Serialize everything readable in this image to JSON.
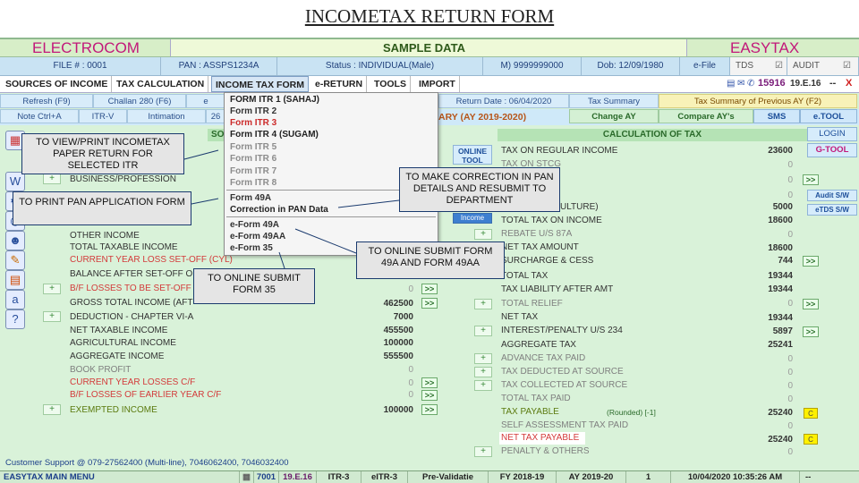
{
  "slide_title": "INCOMETAX RETURN FORM",
  "top": {
    "left_brand": "ELECTROCOM",
    "center": "SAMPLE DATA",
    "right_brand": "EASYTAX"
  },
  "info": {
    "file": "FILE # : 0001",
    "pan": "PAN : ASSPS1234A",
    "status": "Status : INDIVIDUAL(Male)",
    "mobile": "M) 9999999000",
    "dob": "Dob: 12/09/1980",
    "efile": "e-File",
    "tds": "TDS",
    "audit": "AUDIT"
  },
  "menu": [
    "SOURCES OF INCOME",
    "TAX CALCULATION",
    "INCOME TAX FORM",
    "e-RETURN",
    "TOOLS",
    "IMPORT"
  ],
  "toolbar_right": {
    "code": "15916",
    "version": "19.E.16",
    "dash": "--",
    "close": "X"
  },
  "row3": {
    "refresh": "Refresh (F9)",
    "challan": "Challan 280 (F6)",
    "e_prefix": "e",
    "return_date": "Return Date : 06/04/2020",
    "tax_summary": "Tax Summary",
    "tax_summary_prev": "Tax Summary of Previous AY (F2)"
  },
  "row4": {
    "note": "Note Ctrl+A",
    "itrv": "ITR-V",
    "intimation": "Intimation",
    "num": "26",
    "summary_suffix": "ARY (AY 2019-2020)",
    "change_ay": "Change AY",
    "compare": "Compare AY's",
    "sms": "SMS",
    "etool": "e.TOOL"
  },
  "side_buttons": {
    "login": "LOGIN",
    "gtool": "G-TOOL",
    "audit_sw": "Audit S/W",
    "etds_sw": "eTDS S/W"
  },
  "dropdown": {
    "items": [
      {
        "label": "FORM ITR 1 (SAHAJ)",
        "style": "k"
      },
      {
        "label": "Form ITR 2",
        "style": "b"
      },
      {
        "label": "Form ITR 3",
        "style": "r"
      },
      {
        "label": "Form ITR 4 (SUGAM)",
        "style": "k"
      },
      {
        "label": "Form ITR 5",
        "style": "g"
      },
      {
        "label": "Form ITR 6",
        "style": "g"
      },
      {
        "label": "Form ITR 7",
        "style": "g"
      },
      {
        "label": "Form ITR 8",
        "style": "g"
      },
      {
        "label": "Form 49A",
        "style": "b"
      },
      {
        "label": "Correction in PAN Data",
        "style": "k"
      },
      {
        "label": "e-Form 49A",
        "style": "b"
      },
      {
        "label": "e-Form 49AA",
        "style": "b"
      },
      {
        "label": "e-Form 35",
        "style": "b"
      }
    ]
  },
  "left": {
    "header": "SOURC",
    "rows": [
      {
        "label": "BUSINESS/PROFESSION",
        "style": "n"
      },
      {
        "label": "OTHER INCOME",
        "style": "n"
      },
      {
        "label": "TOTAL TAXABLE INCOME",
        "style": "n"
      },
      {
        "label": "CURRENT YEAR LOSS SET-OFF (CYL)",
        "style": "r"
      },
      {
        "label": "BALANCE AFTER SET-OFF O",
        "style": "n"
      },
      {
        "label": "B/F LOSSES TO BE SET-OFF",
        "style": "r",
        "value": "0",
        "vstyle": "g"
      },
      {
        "label": "GROSS TOTAL INCOME (AFT",
        "style": "n",
        "value": "462500"
      },
      {
        "label": "DEDUCTION - CHAPTER VI-A",
        "style": "n",
        "value": "7000"
      },
      {
        "label": "NET TAXABLE INCOME",
        "style": "n",
        "value": "455500"
      },
      {
        "label": "AGRICULTURAL INCOME",
        "style": "n",
        "value": "100000"
      },
      {
        "label": "AGGREGATE INCOME",
        "style": "n",
        "value": "555500"
      },
      {
        "label": "BOOK PROFIT",
        "style": "g",
        "value": "0",
        "vstyle": "g"
      },
      {
        "label": "CURRENT YEAR LOSSES C/F",
        "style": "r",
        "value": "0",
        "vstyle": "g"
      },
      {
        "label": "B/F LOSSES OF EARLIER YEAR C/F",
        "style": "r",
        "value": "0",
        "vstyle": "g"
      },
      {
        "label": "EXEMPTED INCOME",
        "style": "o",
        "value": "100000"
      }
    ]
  },
  "right": {
    "header": "CALCULATION OF TAX",
    "online_tool": "ONLINE TOOL",
    "income_btn": "Income",
    "rows": [
      {
        "label": "TAX ON REGULAR INCOME",
        "style": "n",
        "value": "23600"
      },
      {
        "label": "TAX ON STCG",
        "style": "g",
        "value": "0",
        "vstyle": "g"
      },
      {
        "label": "",
        "style": "g",
        "value": "0",
        "vstyle": "g"
      },
      {
        "label": "",
        "style": "g",
        "value": "0",
        "vstyle": "g"
      },
      {
        "label": "ULTURE)",
        "style": "n",
        "value": "5000"
      },
      {
        "label": "TOTAL TAX ON INCOME",
        "style": "n",
        "value": "18600"
      },
      {
        "label": "REBATE U/S 87A",
        "style": "g",
        "value": "0",
        "vstyle": "g"
      },
      {
        "label": "NET TAX AMOUNT",
        "style": "n",
        "value": "18600"
      },
      {
        "label": "SURCHARGE & CESS",
        "style": "n",
        "value": "744"
      },
      {
        "label": "TOTAL TAX",
        "style": "n",
        "value": "19344"
      },
      {
        "label": "TAX LIABILITY AFTER AMT",
        "style": "n",
        "value": "19344"
      },
      {
        "label": "TOTAL RELIEF",
        "style": "g",
        "value": "0",
        "vstyle": "g"
      },
      {
        "label": "NET TAX",
        "style": "n",
        "value": "19344"
      },
      {
        "label": "INTEREST/PENALTY U/S 234",
        "style": "n",
        "value": "5897"
      },
      {
        "label": "AGGREGATE TAX",
        "style": "n",
        "value": "25241"
      },
      {
        "label": "ADVANCE TAX PAID",
        "style": "g",
        "value": "0",
        "vstyle": "g"
      },
      {
        "label": "TAX DEDUCTED AT SOURCE",
        "style": "g",
        "value": "0",
        "vstyle": "g"
      },
      {
        "label": "TAX COLLECTED AT SOURCE",
        "style": "g",
        "value": "0",
        "vstyle": "g"
      },
      {
        "label": "TOTAL TAX PAID",
        "style": "g",
        "value": "0",
        "vstyle": "g"
      },
      {
        "label": "TAX PAYABLE",
        "style": "o",
        "value": "25240"
      },
      {
        "label": "SELF ASSESSMENT TAX PAID",
        "style": "g",
        "value": "0",
        "vstyle": "g"
      },
      {
        "label": "NET TAX PAYABLE",
        "style": "r",
        "value": "25240"
      },
      {
        "label": "PENALTY & OTHERS",
        "style": "g",
        "value": "0",
        "vstyle": "g"
      }
    ],
    "rounded": "(Rounded) [-1]",
    "c_label": "C",
    "more_label": ">>",
    "plus_label": "+"
  },
  "callouts": {
    "view_print": "TO VIEW/PRINT INCOMETAX PAPER RETURN FOR SELECTED ITR",
    "pan_app": "TO PRINT PAN APPLICATION FORM",
    "correction": "TO MAKE CORRECTION IN PAN DETAILS AND RESUBMIT TO DEPARTMENT",
    "online_49a": "TO ONLINE SUBMIT FORM 49A AND FORM 49AA",
    "online_35": "TO ONLINE SUBMIT FORM 35"
  },
  "support": "Customer Support @ 079-27562400 (Multi-line), 7046062400, 7046032400",
  "statusbar": {
    "main_menu": "EASYTAX MAIN MENU",
    "code": "7001",
    "version": "19.E.16",
    "itr": "ITR-3",
    "eitr": "eITR-3",
    "prevalid": "Pre-Validatie",
    "fy": "FY 2018-19",
    "ay": "AY 2019-20",
    "count": "1",
    "datetime": "10/04/2020 10:35:26 AM",
    "dash": "--"
  }
}
